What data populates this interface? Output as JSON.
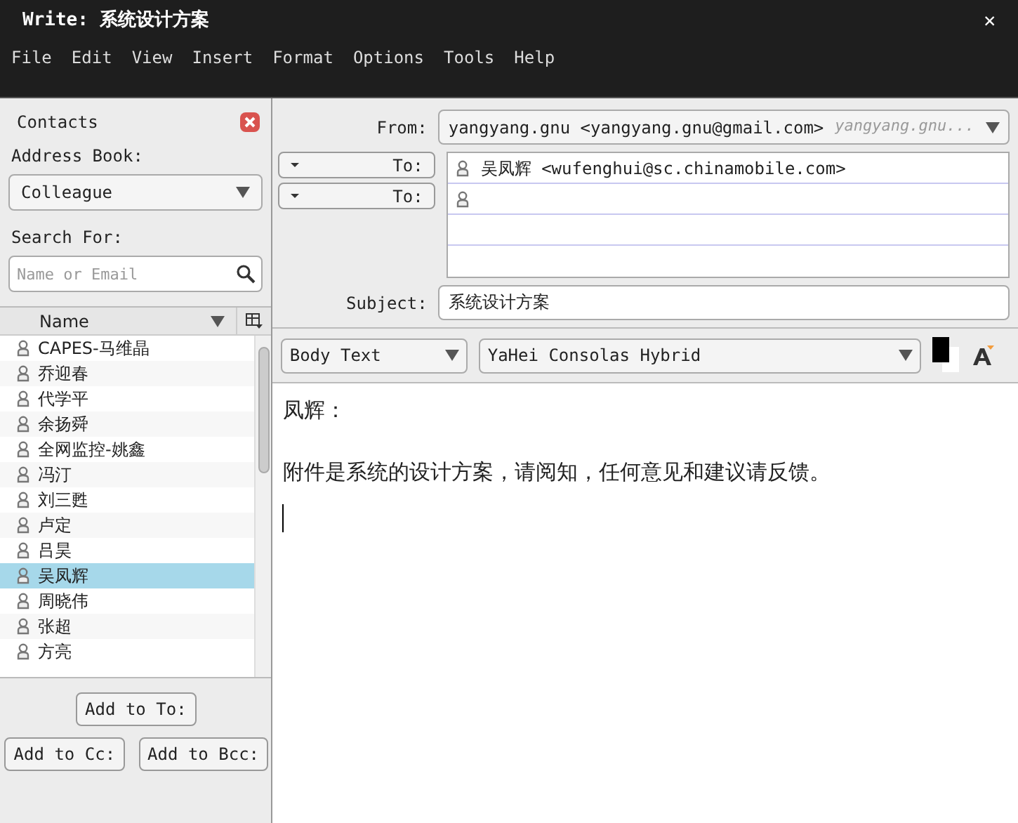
{
  "window": {
    "title": "Write: 系统设计方案",
    "close": "✕"
  },
  "menu": [
    "File",
    "Edit",
    "View",
    "Insert",
    "Format",
    "Options",
    "Tools",
    "Help"
  ],
  "contacts": {
    "title": "Contacts",
    "address_book_label": "Address Book:",
    "address_book": "Colleague",
    "search_label": "Search For:",
    "search": {
      "placeholder": "Name or Email"
    },
    "column": "Name",
    "items": [
      {
        "name": "CAPES-马维晶",
        "selected": false
      },
      {
        "name": "乔迎春",
        "selected": false
      },
      {
        "name": "代学平",
        "selected": false
      },
      {
        "name": "余扬舜",
        "selected": false
      },
      {
        "name": "全网监控-姚鑫",
        "selected": false
      },
      {
        "name": "冯汀",
        "selected": false
      },
      {
        "name": "刘三甦",
        "selected": false
      },
      {
        "name": "卢定",
        "selected": false
      },
      {
        "name": "吕昊",
        "selected": false
      },
      {
        "name": "吴凤辉",
        "selected": true
      },
      {
        "name": "周晓伟",
        "selected": false
      },
      {
        "name": "张超",
        "selected": false
      },
      {
        "name": "方亮",
        "selected": false
      }
    ],
    "buttons": [
      "Add to To:",
      "Add to Cc:",
      "Add to Bcc:"
    ]
  },
  "header": {
    "from_label": "From:",
    "from": "yangyang.gnu <yangyang.gnu@gmail.com>",
    "from_hint": "yangyang.gnu...",
    "recipients": [
      {
        "type": "To:",
        "value": "吴凤辉 <wufenghui@sc.chinamobile.com>"
      },
      {
        "type": "To:"
      }
    ],
    "subject_label": "Subject:",
    "subject": "系统设计方案"
  },
  "format": {
    "paragraph": "Body Text",
    "font": "YaHei Consolas Hybrid"
  },
  "body": [
    "凤辉：",
    "附件是系统的设计方案，请阅知，任何意见和建议请反馈。"
  ]
}
